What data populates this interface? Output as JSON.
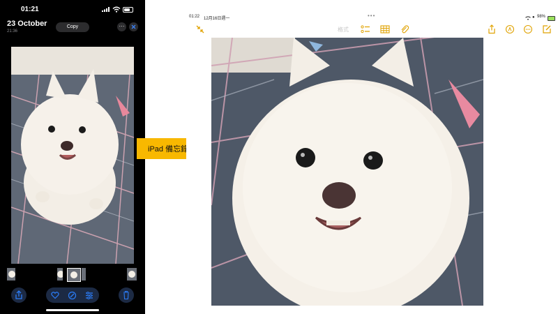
{
  "phone": {
    "status_time": "01:21",
    "date_title": "23 October",
    "time_sub": "21:36",
    "copy_label": "Copy",
    "more_label": "···",
    "toolbar_icons": [
      "share-icon",
      "heart-icon",
      "edit-icon",
      "adjust-icon",
      "trash-icon"
    ]
  },
  "arrow": {
    "label": "iPad 備忘錄",
    "color": "#f8b800"
  },
  "ipad": {
    "status_time": "01:22",
    "status_date": "12月16日週一",
    "dots": "•••",
    "battery_pct": "98%",
    "format_label": "格式",
    "accent": "#e0a200",
    "toolbar_icons": [
      "collapse-icon",
      "checklist-icon",
      "table-icon",
      "paperclip-icon",
      "share-icon",
      "markup-icon",
      "more-icon",
      "compose-icon"
    ]
  },
  "colors": {
    "phone_bg": "#000000",
    "toolbar_accent": "#2b7cf6"
  }
}
